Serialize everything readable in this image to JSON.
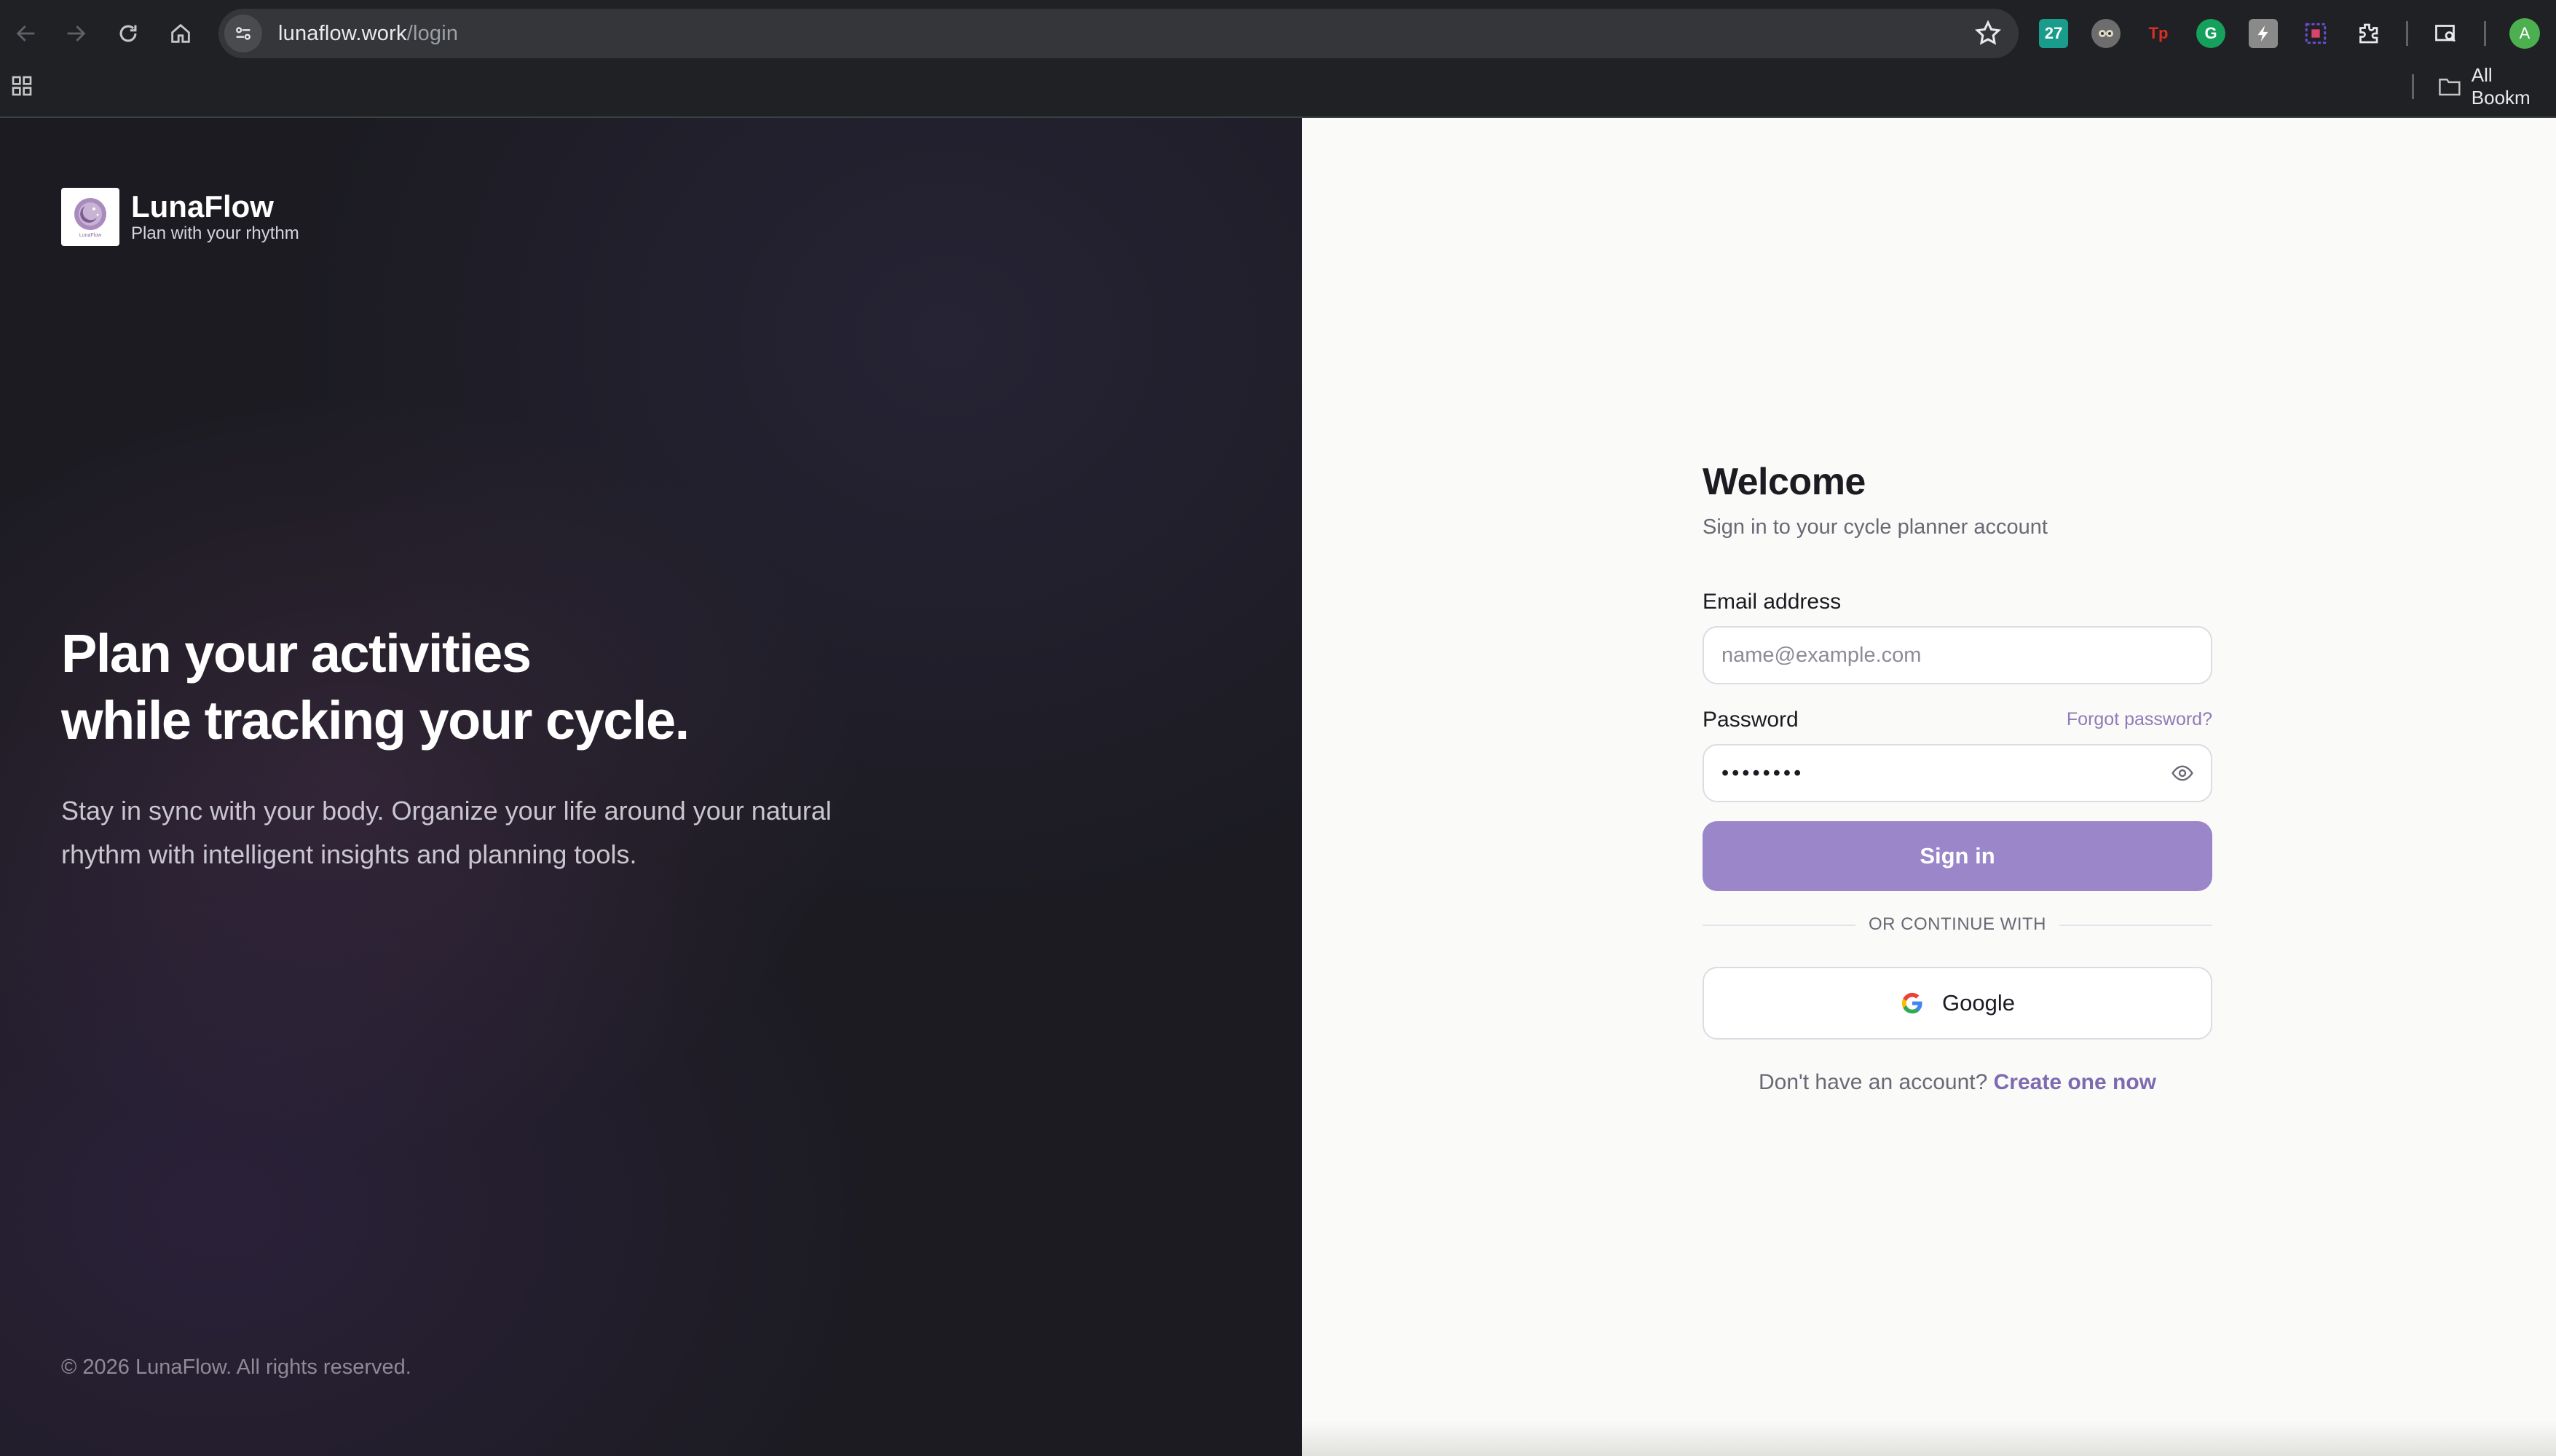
{
  "browser": {
    "url_host": "lunaflow.work",
    "url_path": "/login",
    "extensions": [
      {
        "name": "calendar-extension-icon",
        "text": "27",
        "color": "#1a9c8c"
      },
      {
        "name": "eyes-extension-icon",
        "text": "",
        "color": "#6d6d6d"
      },
      {
        "name": "tp-extension-icon",
        "text": "Tp",
        "color": "#d93025"
      },
      {
        "name": "grammarly-extension-icon",
        "text": "G",
        "color": "#15a05c"
      },
      {
        "name": "bolt-extension-icon",
        "text": "",
        "color": "#8a8a8a"
      },
      {
        "name": "select-extension-icon",
        "text": "",
        "color": "#6a4fd6"
      }
    ],
    "profile_initial": "A",
    "bookmarks_label": "All Bookm"
  },
  "brand": {
    "name": "LunaFlow",
    "tagline": "Plan with your rhythm",
    "logo_small_text": "LunaFlow"
  },
  "hero": {
    "line1": "Plan your activities",
    "line2": "while tracking your cycle.",
    "subtitle": "Stay in sync with your body. Organize your life around your natural rhythm with intelligent insights and planning tools."
  },
  "footer": {
    "copyright": "© 2026 LunaFlow. All rights reserved."
  },
  "login": {
    "title": "Welcome",
    "subtitle": "Sign in to your cycle planner account",
    "email_label": "Email address",
    "email_placeholder": "name@example.com",
    "email_value": "",
    "password_label": "Password",
    "forgot_password": "Forgot password?",
    "password_value": "••••••••",
    "signin_button": "Sign in",
    "divider": "OR CONTINUE WITH",
    "google_button": "Google",
    "signup_prompt": "Don't have an account?",
    "signup_link": "Create one now"
  },
  "colors": {
    "accent": "#9a86c8",
    "link": "#7e6aae",
    "left_bg": "#1c1b22",
    "right_bg": "#fafaf9"
  }
}
